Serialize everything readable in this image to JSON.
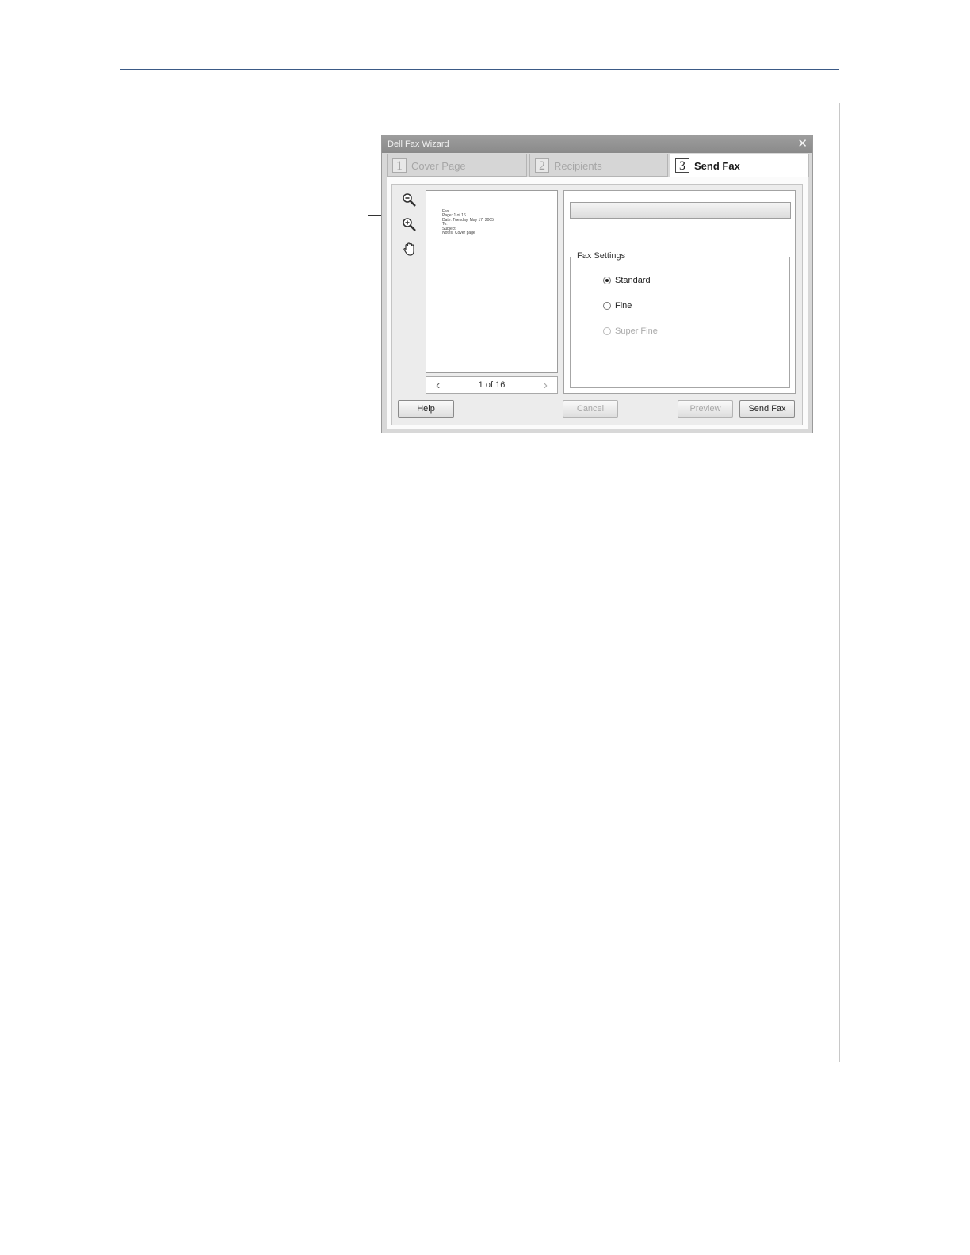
{
  "window": {
    "title": "Dell Fax Wizard",
    "close_glyph": "✕"
  },
  "tabs": [
    {
      "number": "1",
      "label": "Cover Page",
      "active": false
    },
    {
      "number": "2",
      "label": "Recipients",
      "active": false
    },
    {
      "number": "3",
      "label": "Send Fax",
      "active": true
    }
  ],
  "toolbar": {
    "icons": [
      "zoom-out-icon",
      "zoom-in-icon",
      "hand-pan-icon"
    ]
  },
  "preview": {
    "doc_lines": [
      "         Fax",
      "Page: 1 of 16",
      "Date: Tuesday, May 17, 2005",
      "To:",
      "Subject:",
      "Notes: Cover page"
    ],
    "pager": {
      "prev_glyph": "‹",
      "next_glyph": "›",
      "page_text": "1 of 16"
    }
  },
  "progress": {
    "value": 0
  },
  "fax_settings": {
    "legend": "Fax Settings",
    "options": [
      {
        "label": "Standard",
        "selected": true,
        "enabled": true
      },
      {
        "label": "Fine",
        "selected": false,
        "enabled": true
      },
      {
        "label": "Super Fine",
        "selected": false,
        "enabled": false
      }
    ]
  },
  "buttons": {
    "help": "Help",
    "cancel": "Cancel",
    "preview": "Preview",
    "send_fax": "Send Fax"
  }
}
